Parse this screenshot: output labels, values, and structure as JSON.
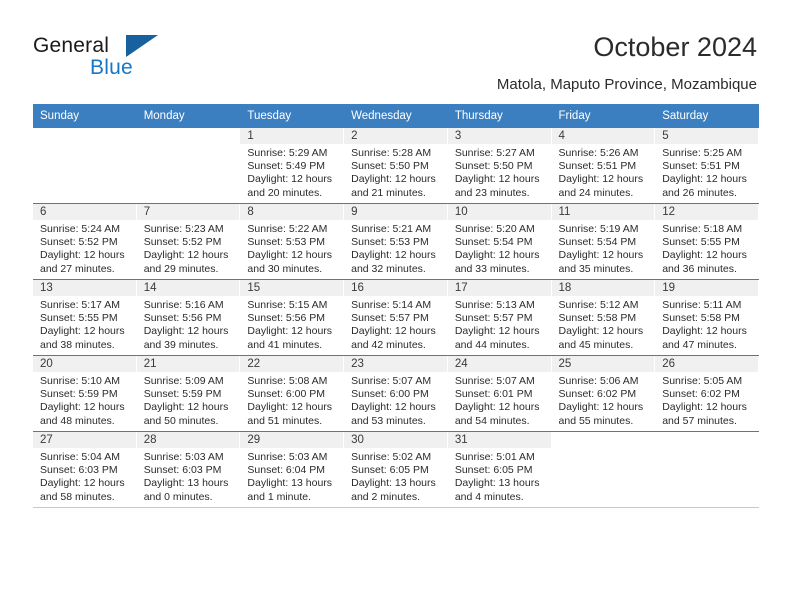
{
  "brand": {
    "name_part1": "General",
    "name_part2": "Blue",
    "logo_icon": "triangle-icon"
  },
  "header": {
    "title": "October 2024",
    "subtitle": "Matola, Maputo Province, Mozambique"
  },
  "colors": {
    "header_blue": "#3c7fc1",
    "brand_blue": "#1777c4",
    "daynum_bg": "#f0f0f0",
    "text": "#2b2b2b"
  },
  "calendar": {
    "weekday_headers": [
      "Sunday",
      "Monday",
      "Tuesday",
      "Wednesday",
      "Thursday",
      "Friday",
      "Saturday"
    ],
    "weeks": [
      [
        {
          "day": "",
          "lines": []
        },
        {
          "day": "",
          "lines": []
        },
        {
          "day": "1",
          "lines": [
            "Sunrise: 5:29 AM",
            "Sunset: 5:49 PM",
            "Daylight: 12 hours",
            "and 20 minutes."
          ]
        },
        {
          "day": "2",
          "lines": [
            "Sunrise: 5:28 AM",
            "Sunset: 5:50 PM",
            "Daylight: 12 hours",
            "and 21 minutes."
          ]
        },
        {
          "day": "3",
          "lines": [
            "Sunrise: 5:27 AM",
            "Sunset: 5:50 PM",
            "Daylight: 12 hours",
            "and 23 minutes."
          ]
        },
        {
          "day": "4",
          "lines": [
            "Sunrise: 5:26 AM",
            "Sunset: 5:51 PM",
            "Daylight: 12 hours",
            "and 24 minutes."
          ]
        },
        {
          "day": "5",
          "lines": [
            "Sunrise: 5:25 AM",
            "Sunset: 5:51 PM",
            "Daylight: 12 hours",
            "and 26 minutes."
          ]
        }
      ],
      [
        {
          "day": "6",
          "lines": [
            "Sunrise: 5:24 AM",
            "Sunset: 5:52 PM",
            "Daylight: 12 hours",
            "and 27 minutes."
          ]
        },
        {
          "day": "7",
          "lines": [
            "Sunrise: 5:23 AM",
            "Sunset: 5:52 PM",
            "Daylight: 12 hours",
            "and 29 minutes."
          ]
        },
        {
          "day": "8",
          "lines": [
            "Sunrise: 5:22 AM",
            "Sunset: 5:53 PM",
            "Daylight: 12 hours",
            "and 30 minutes."
          ]
        },
        {
          "day": "9",
          "lines": [
            "Sunrise: 5:21 AM",
            "Sunset: 5:53 PM",
            "Daylight: 12 hours",
            "and 32 minutes."
          ]
        },
        {
          "day": "10",
          "lines": [
            "Sunrise: 5:20 AM",
            "Sunset: 5:54 PM",
            "Daylight: 12 hours",
            "and 33 minutes."
          ]
        },
        {
          "day": "11",
          "lines": [
            "Sunrise: 5:19 AM",
            "Sunset: 5:54 PM",
            "Daylight: 12 hours",
            "and 35 minutes."
          ]
        },
        {
          "day": "12",
          "lines": [
            "Sunrise: 5:18 AM",
            "Sunset: 5:55 PM",
            "Daylight: 12 hours",
            "and 36 minutes."
          ]
        }
      ],
      [
        {
          "day": "13",
          "lines": [
            "Sunrise: 5:17 AM",
            "Sunset: 5:55 PM",
            "Daylight: 12 hours",
            "and 38 minutes."
          ]
        },
        {
          "day": "14",
          "lines": [
            "Sunrise: 5:16 AM",
            "Sunset: 5:56 PM",
            "Daylight: 12 hours",
            "and 39 minutes."
          ]
        },
        {
          "day": "15",
          "lines": [
            "Sunrise: 5:15 AM",
            "Sunset: 5:56 PM",
            "Daylight: 12 hours",
            "and 41 minutes."
          ]
        },
        {
          "day": "16",
          "lines": [
            "Sunrise: 5:14 AM",
            "Sunset: 5:57 PM",
            "Daylight: 12 hours",
            "and 42 minutes."
          ]
        },
        {
          "day": "17",
          "lines": [
            "Sunrise: 5:13 AM",
            "Sunset: 5:57 PM",
            "Daylight: 12 hours",
            "and 44 minutes."
          ]
        },
        {
          "day": "18",
          "lines": [
            "Sunrise: 5:12 AM",
            "Sunset: 5:58 PM",
            "Daylight: 12 hours",
            "and 45 minutes."
          ]
        },
        {
          "day": "19",
          "lines": [
            "Sunrise: 5:11 AM",
            "Sunset: 5:58 PM",
            "Daylight: 12 hours",
            "and 47 minutes."
          ]
        }
      ],
      [
        {
          "day": "20",
          "lines": [
            "Sunrise: 5:10 AM",
            "Sunset: 5:59 PM",
            "Daylight: 12 hours",
            "and 48 minutes."
          ]
        },
        {
          "day": "21",
          "lines": [
            "Sunrise: 5:09 AM",
            "Sunset: 5:59 PM",
            "Daylight: 12 hours",
            "and 50 minutes."
          ]
        },
        {
          "day": "22",
          "lines": [
            "Sunrise: 5:08 AM",
            "Sunset: 6:00 PM",
            "Daylight: 12 hours",
            "and 51 minutes."
          ]
        },
        {
          "day": "23",
          "lines": [
            "Sunrise: 5:07 AM",
            "Sunset: 6:00 PM",
            "Daylight: 12 hours",
            "and 53 minutes."
          ]
        },
        {
          "day": "24",
          "lines": [
            "Sunrise: 5:07 AM",
            "Sunset: 6:01 PM",
            "Daylight: 12 hours",
            "and 54 minutes."
          ]
        },
        {
          "day": "25",
          "lines": [
            "Sunrise: 5:06 AM",
            "Sunset: 6:02 PM",
            "Daylight: 12 hours",
            "and 55 minutes."
          ]
        },
        {
          "day": "26",
          "lines": [
            "Sunrise: 5:05 AM",
            "Sunset: 6:02 PM",
            "Daylight: 12 hours",
            "and 57 minutes."
          ]
        }
      ],
      [
        {
          "day": "27",
          "lines": [
            "Sunrise: 5:04 AM",
            "Sunset: 6:03 PM",
            "Daylight: 12 hours",
            "and 58 minutes."
          ]
        },
        {
          "day": "28",
          "lines": [
            "Sunrise: 5:03 AM",
            "Sunset: 6:03 PM",
            "Daylight: 13 hours",
            "and 0 minutes."
          ]
        },
        {
          "day": "29",
          "lines": [
            "Sunrise: 5:03 AM",
            "Sunset: 6:04 PM",
            "Daylight: 13 hours",
            "and 1 minute."
          ]
        },
        {
          "day": "30",
          "lines": [
            "Sunrise: 5:02 AM",
            "Sunset: 6:05 PM",
            "Daylight: 13 hours",
            "and 2 minutes."
          ]
        },
        {
          "day": "31",
          "lines": [
            "Sunrise: 5:01 AM",
            "Sunset: 6:05 PM",
            "Daylight: 13 hours",
            "and 4 minutes."
          ]
        },
        {
          "day": "",
          "lines": []
        },
        {
          "day": "",
          "lines": []
        }
      ]
    ]
  }
}
